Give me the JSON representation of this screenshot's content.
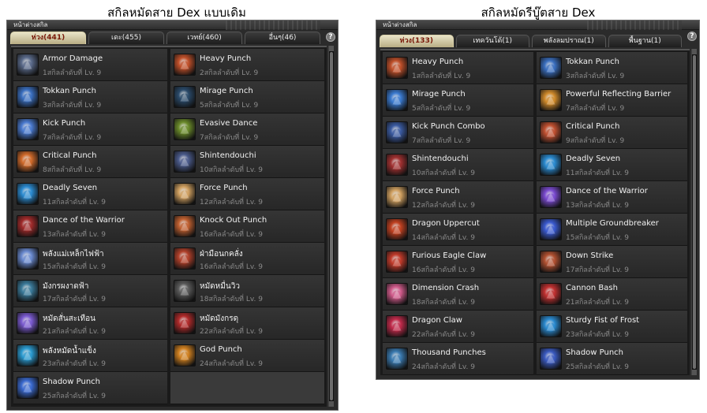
{
  "captions": {
    "left": "สกิลหมัดสาย Dex แบบเดิม",
    "right": "สกิลหมัดรีบู๊ตสาย Dex"
  },
  "left_window": {
    "title": "หน้าต่างสกิล",
    "help": "?",
    "tabs": [
      "ห่วง(441)",
      "เดะ(455)",
      "เวทย์(460)",
      "อื่นๆ(46)"
    ],
    "active_tab": 0,
    "skills": [
      {
        "name": "Armor Damage",
        "level": "1สกิลลำดับที่ Lv. 9",
        "icon": "armor-damage-icon",
        "color": "#5a6a8a"
      },
      {
        "name": "Heavy Punch",
        "level": "2สกิลลำดับที่ Lv. 9",
        "icon": "heavy-punch-icon",
        "color": "#c0502a"
      },
      {
        "name": "Tokkan Punch",
        "level": "3สกิลลำดับที่ Lv. 9",
        "icon": "tokkan-punch-icon",
        "color": "#3a6fc0"
      },
      {
        "name": "Mirage Punch",
        "level": "5สกิลลำดับที่ Lv. 9",
        "icon": "mirage-punch-icon",
        "color": "#2a4a6a"
      },
      {
        "name": "Kick Punch",
        "level": "7สกิลลำดับที่ Lv. 9",
        "icon": "kick-punch-icon",
        "color": "#4a7ad0"
      },
      {
        "name": "Evasive Dance",
        "level": "7สกิลลำดับที่ Lv. 9",
        "icon": "evasive-dance-icon",
        "color": "#6a8a2a"
      },
      {
        "name": "Critical Punch",
        "level": "8สกิลลำดับที่ Lv. 9",
        "icon": "critical-punch-icon",
        "color": "#d06a2a"
      },
      {
        "name": "Shintendouchi",
        "level": "10สกิลลำดับที่ Lv. 9",
        "icon": "shintendouchi-icon",
        "color": "#4a5a8a"
      },
      {
        "name": "Deadly Seven",
        "level": "11สกิลลำดับที่ Lv. 9",
        "icon": "deadly-seven-icon",
        "color": "#2a8ad0"
      },
      {
        "name": "Force Punch",
        "level": "12สกิลลำดับที่ Lv. 9",
        "icon": "force-punch-icon",
        "color": "#d0a060"
      },
      {
        "name": "Dance of the Warrior",
        "level": "13สกิลลำดับที่ Lv. 9",
        "icon": "dance-of-the-warrior-icon",
        "color": "#a02a2a"
      },
      {
        "name": "Knock Out Punch",
        "level": "16สกิลลำดับที่ Lv. 9",
        "icon": "knock-out-punch-icon",
        "color": "#c06030"
      },
      {
        "name": "พลังแม่เหล็กไฟฟ้า",
        "level": "15สกิลลำดับที่ Lv. 9",
        "icon": "electromagnetic-power-icon",
        "color": "#6a8ad0"
      },
      {
        "name": "ฝ่ามือนกคลั่ง",
        "level": "16สกิลลำดับที่ Lv. 9",
        "icon": "crazy-bird-palm-icon",
        "color": "#b0402a"
      },
      {
        "name": "มังกรผงาดฟ้า",
        "level": "17สกิลลำดับที่ Lv. 9",
        "icon": "rising-dragon-icon",
        "color": "#3a7a9a"
      },
      {
        "name": "หมัดหมื่นวิว",
        "level": "18สกิลลำดับที่ Lv. 9",
        "icon": "myriad-fist-icon",
        "color": "#5a5a5a"
      },
      {
        "name": "หมัดสั่นสะเทือน",
        "level": "21สกิลลำดับที่ Lv. 9",
        "icon": "shock-fist-icon",
        "color": "#7a5ad0"
      },
      {
        "name": "หมัดมังกรดุ",
        "level": "22สกิลลำดับที่ Lv. 9",
        "icon": "fierce-dragon-fist-icon",
        "color": "#b02a2a"
      },
      {
        "name": "พลังหมัดน้ำแข็ง",
        "level": "23สกิลลำดับที่ Lv. 9",
        "icon": "ice-fist-power-icon",
        "color": "#2a9ad0"
      },
      {
        "name": "God Punch",
        "level": "24สกิลลำดับที่ Lv. 9",
        "icon": "god-punch-icon",
        "color": "#d08020"
      },
      {
        "name": "Shadow Punch",
        "level": "25สกิลลำดับที่ Lv. 9",
        "icon": "shadow-punch-icon",
        "color": "#3a6ad0"
      }
    ]
  },
  "right_window": {
    "title": "หน้าต่างสกิล",
    "help": "?",
    "tabs": [
      "ห่วง(133)",
      "เทควันโด้(1)",
      "พลังลมปราณ(1)",
      "พื้นฐาน(1)"
    ],
    "active_tab": 0,
    "skills": [
      {
        "name": "Heavy Punch",
        "level": "1สกิลลำดับที่ Lv. 9",
        "icon": "heavy-punch-icon",
        "color": "#c0502a"
      },
      {
        "name": "Tokkan Punch",
        "level": "3สกิลลำดับที่ Lv. 9",
        "icon": "tokkan-punch-icon",
        "color": "#3a6fc0"
      },
      {
        "name": "Mirage Punch",
        "level": "5สกิลลำดับที่ Lv. 9",
        "icon": "mirage-punch-icon",
        "color": "#3a7ad0"
      },
      {
        "name": "Powerful Reflecting Barrier",
        "level": "7สกิลลำดับที่ Lv. 9",
        "icon": "reflecting-barrier-icon",
        "color": "#d08a2a"
      },
      {
        "name": "Kick Punch Combo",
        "level": "7สกิลลำดับที่ Lv. 9",
        "icon": "kick-punch-combo-icon",
        "color": "#3a5aa0"
      },
      {
        "name": "Critical Punch",
        "level": "9สกิลลำดับที่ Lv. 9",
        "icon": "critical-punch-icon",
        "color": "#c05030"
      },
      {
        "name": "Shintendouchi",
        "level": "10สกิลลำดับที่ Lv. 9",
        "icon": "shintendouchi-icon",
        "color": "#a03030"
      },
      {
        "name": "Deadly Seven",
        "level": "11สกิลลำดับที่ Lv. 9",
        "icon": "deadly-seven-icon",
        "color": "#2a8ad0"
      },
      {
        "name": "Force Punch",
        "level": "12สกิลลำดับที่ Lv. 9",
        "icon": "force-punch-icon",
        "color": "#d0a060"
      },
      {
        "name": "Dance of the Warrior",
        "level": "13สกิลลำดับที่ Lv. 9",
        "icon": "dance-of-the-warrior-icon",
        "color": "#7a4ad0"
      },
      {
        "name": "Dragon Uppercut",
        "level": "14สกิลลำดับที่ Lv. 9",
        "icon": "dragon-uppercut-icon",
        "color": "#c04020"
      },
      {
        "name": "Multiple Groundbreaker",
        "level": "15สกิลลำดับที่ Lv. 9",
        "icon": "multiple-groundbreaker-icon",
        "color": "#3a5ad0"
      },
      {
        "name": "Furious Eagle Claw",
        "level": "16สกิลลำดับที่ Lv. 9",
        "icon": "furious-eagle-claw-icon",
        "color": "#c03a2a"
      },
      {
        "name": "Down Strike",
        "level": "17สกิลลำดับที่ Lv. 9",
        "icon": "down-strike-icon",
        "color": "#b05030"
      },
      {
        "name": "Dimension Crash",
        "level": "18สกิลลำดับที่ Lv. 9",
        "icon": "dimension-crash-icon",
        "color": "#d05a8a"
      },
      {
        "name": "Cannon Bash",
        "level": "21สกิลลำดับที่ Lv. 9",
        "icon": "cannon-bash-icon",
        "color": "#c03030"
      },
      {
        "name": "Dragon Claw",
        "level": "22สกิลลำดับที่ Lv. 9",
        "icon": "dragon-claw-icon",
        "color": "#c02a4a"
      },
      {
        "name": "Sturdy Fist of Frost",
        "level": "23สกิลลำดับที่ Lv. 9",
        "icon": "sturdy-fist-of-frost-icon",
        "color": "#2a8ad0"
      },
      {
        "name": "Thousand Punches",
        "level": "24สกิลลำดับที่ Lv. 9",
        "icon": "thousand-punches-icon",
        "color": "#3a7ab0"
      },
      {
        "name": "Shadow Punch",
        "level": "25สกิลลำดับที่ Lv. 9",
        "icon": "shadow-punch-icon",
        "color": "#3a5ac0"
      }
    ]
  }
}
